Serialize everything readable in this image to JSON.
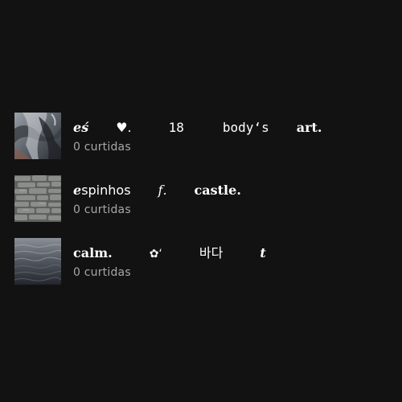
{
  "playlists": [
    {
      "title_parts": [
        "𝒆",
        "ś",
        "♥︎.",
        "18",
        "body‘s",
        "art."
      ],
      "subtitle": "0 curtidas",
      "cover": "fabric-texture-cover"
    },
    {
      "title_parts": [
        "𝒆",
        "spinhos",
        "𝑓.",
        "castle."
      ],
      "subtitle": "0 curtidas",
      "cover": "stone-wall-cover"
    },
    {
      "title_parts": [
        "calm.",
        "✿‘",
        "바다",
        "𝒕"
      ],
      "subtitle": "0 curtidas",
      "cover": "ocean-water-cover"
    }
  ]
}
